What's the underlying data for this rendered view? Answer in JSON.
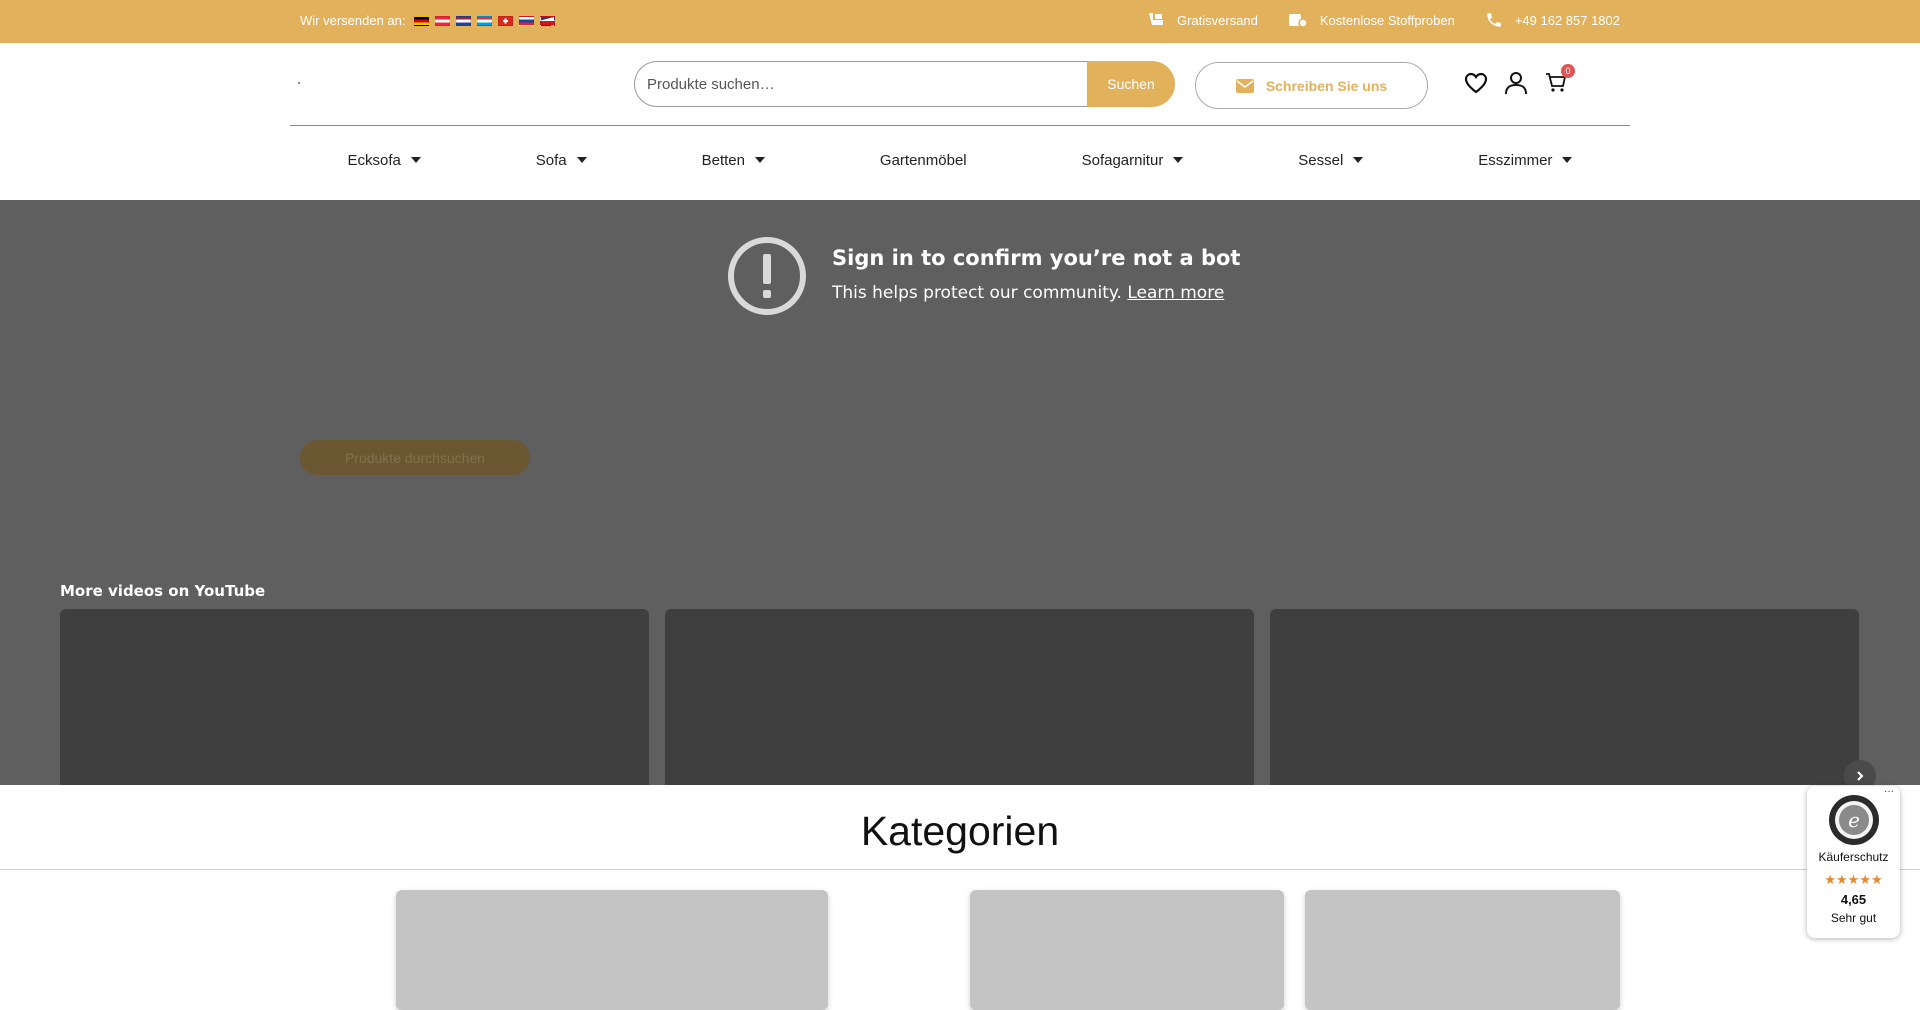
{
  "topbar": {
    "ship_label": "Wir versenden an:",
    "flags": [
      "de-flag-icon",
      "at-flag-icon",
      "nl-flag-icon",
      "lu-flag-icon",
      "ch-flag-icon",
      "sk-flag-icon",
      "cz-flag-icon"
    ],
    "items": [
      {
        "icon": "shipping-icon",
        "label": "Gratisversand"
      },
      {
        "icon": "fabric-samples-icon",
        "label": "Kostenlose Stoffproben"
      },
      {
        "icon": "phone-icon",
        "label": "+49 162 857 1802"
      }
    ],
    "bg_color": "#e2b15c"
  },
  "header": {
    "search": {
      "placeholder": "Produkte suchen…",
      "button_label": "Suchen"
    },
    "write_button": {
      "icon": "mail-icon",
      "label": "Schreiben Sie uns"
    },
    "icons": [
      "heart-icon",
      "user-icon",
      "cart-icon"
    ],
    "cart_count": "0"
  },
  "nav": {
    "items": [
      {
        "label": "Ecksofa",
        "dropdown": true
      },
      {
        "label": "Sofa",
        "dropdown": true
      },
      {
        "label": "Betten",
        "dropdown": true
      },
      {
        "label": "Gartenmöbel",
        "dropdown": false
      },
      {
        "label": "Sofagarnitur",
        "dropdown": true
      },
      {
        "label": "Sessel",
        "dropdown": true
      },
      {
        "label": "Esszimmer",
        "dropdown": true
      }
    ]
  },
  "video": {
    "title": "Sign in to confirm you’re not a bot",
    "subtitle": "This helps protect our community.",
    "learn_more": "Learn more",
    "browse_button": "Produkte durchsuchen",
    "more_videos": "More videos on YouTube"
  },
  "categories": {
    "title": "Kategorien"
  },
  "trusted_shops": {
    "label": "Käuferschutz",
    "stars": "★★★★★",
    "score": "4,65",
    "rating_text": "Sehr gut",
    "more": "···"
  }
}
